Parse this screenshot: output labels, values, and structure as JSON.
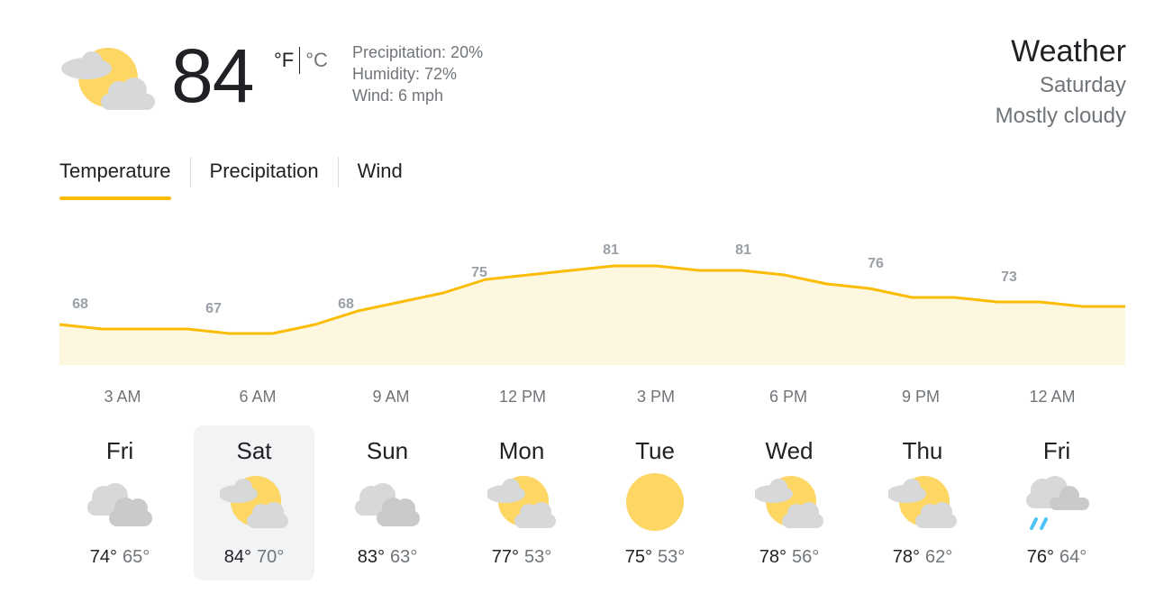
{
  "current": {
    "temperature": "84",
    "unit_f": "°F",
    "unit_c": "°C",
    "precipitation": "Precipitation: 20%",
    "humidity": "Humidity: 72%",
    "wind": "Wind: 6 mph",
    "icon": "partly-cloudy-icon"
  },
  "header": {
    "title": "Weather",
    "day": "Saturday",
    "condition": "Mostly cloudy"
  },
  "tabs": [
    {
      "label": "Temperature",
      "active": true
    },
    {
      "label": "Precipitation",
      "active": false
    },
    {
      "label": "Wind",
      "active": false
    }
  ],
  "chart_data": {
    "type": "area",
    "x": [
      "",
      "3 AM",
      "",
      "6 AM",
      "",
      "9 AM",
      "",
      "12 PM",
      "",
      "3 PM",
      "",
      "6 PM",
      "",
      "9 PM",
      "",
      "12 AM",
      ""
    ],
    "time_labels": [
      "3 AM",
      "6 AM",
      "9 AM",
      "12 PM",
      "3 PM",
      "6 PM",
      "9 PM",
      "12 AM"
    ],
    "values": [
      68,
      67,
      67,
      67,
      66,
      66,
      68,
      71,
      73,
      75,
      78,
      79,
      80,
      81,
      81,
      80,
      80,
      79,
      77,
      76,
      74,
      74,
      73,
      73,
      72,
      72
    ],
    "labels": [
      68,
      67,
      68,
      75,
      81,
      81,
      76,
      73
    ],
    "ylim": [
      40,
      90
    ],
    "color": "#fbbc04",
    "fill": "#fef7e0"
  },
  "forecast": [
    {
      "day": "Fri",
      "hi": "74°",
      "lo": "65°",
      "icon": "cloudy-icon",
      "selected": false
    },
    {
      "day": "Sat",
      "hi": "84°",
      "lo": "70°",
      "icon": "partly-cloudy-icon",
      "selected": true
    },
    {
      "day": "Sun",
      "hi": "83°",
      "lo": "63°",
      "icon": "cloudy-icon",
      "selected": false
    },
    {
      "day": "Mon",
      "hi": "77°",
      "lo": "53°",
      "icon": "partly-cloudy-icon",
      "selected": false
    },
    {
      "day": "Tue",
      "hi": "75°",
      "lo": "53°",
      "icon": "sunny-icon",
      "selected": false
    },
    {
      "day": "Wed",
      "hi": "78°",
      "lo": "56°",
      "icon": "partly-cloudy-icon",
      "selected": false
    },
    {
      "day": "Thu",
      "hi": "78°",
      "lo": "62°",
      "icon": "partly-cloudy-icon",
      "selected": false
    },
    {
      "day": "Fri",
      "hi": "76°",
      "lo": "64°",
      "icon": "rain-icon",
      "selected": false
    }
  ],
  "colors": {
    "accent": "#fbbc04",
    "sun": "#fdd663",
    "cloud": "#dadce0",
    "rain": "#4fc3f7"
  }
}
